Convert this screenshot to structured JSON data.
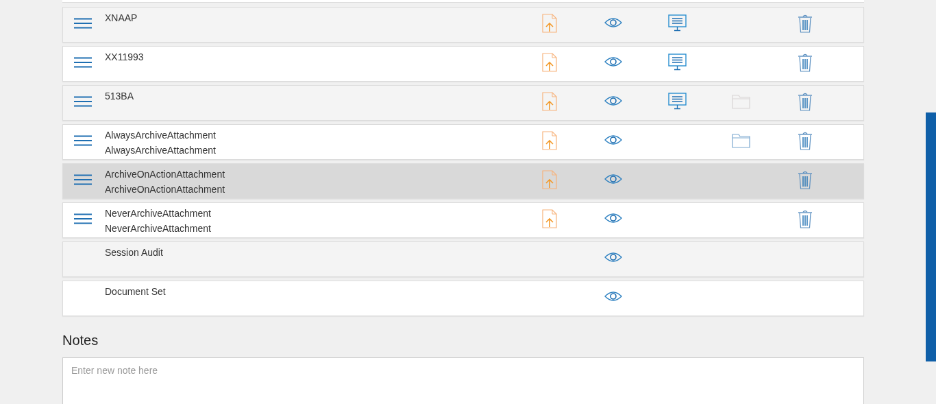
{
  "rows": [
    {
      "lines": [
        "XNAAP"
      ],
      "selected": false,
      "actions": [
        {
          "kind": "drag",
          "disabled": false
        },
        {
          "kind": "upload",
          "disabled": false
        },
        {
          "kind": "view",
          "disabled": false
        },
        {
          "kind": "presentation",
          "disabled": false
        },
        {
          "kind": "delete",
          "disabled": false
        }
      ]
    },
    {
      "lines": [
        "XX11993"
      ],
      "selected": false,
      "actions": [
        {
          "kind": "drag",
          "disabled": false
        },
        {
          "kind": "upload",
          "disabled": false
        },
        {
          "kind": "view",
          "disabled": false
        },
        {
          "kind": "presentation",
          "disabled": false
        },
        {
          "kind": "delete",
          "disabled": false
        }
      ]
    },
    {
      "lines": [
        "513BA"
      ],
      "selected": false,
      "actions": [
        {
          "kind": "drag",
          "disabled": false
        },
        {
          "kind": "upload",
          "disabled": false
        },
        {
          "kind": "view",
          "disabled": false
        },
        {
          "kind": "presentation",
          "disabled": false
        },
        {
          "kind": "folder",
          "disabled": true
        },
        {
          "kind": "delete",
          "disabled": false
        }
      ]
    },
    {
      "lines": [
        "AlwaysArchiveAttachment",
        "AlwaysArchiveAttachment"
      ],
      "selected": false,
      "actions": [
        {
          "kind": "drag",
          "disabled": false
        },
        {
          "kind": "upload",
          "disabled": false
        },
        {
          "kind": "view",
          "disabled": false
        },
        {
          "kind": "folder",
          "disabled": false
        },
        {
          "kind": "delete",
          "disabled": false
        }
      ]
    },
    {
      "lines": [
        "ArchiveOnActionAttachment",
        "ArchiveOnActionAttachment"
      ],
      "selected": true,
      "actions": [
        {
          "kind": "drag",
          "disabled": false
        },
        {
          "kind": "upload",
          "disabled": false
        },
        {
          "kind": "view",
          "disabled": false
        },
        {
          "kind": "delete",
          "disabled": false
        }
      ]
    },
    {
      "lines": [
        "NeverArchiveAttachment",
        "NeverArchiveAttachment"
      ],
      "selected": false,
      "actions": [
        {
          "kind": "drag",
          "disabled": false
        },
        {
          "kind": "upload",
          "disabled": false
        },
        {
          "kind": "view",
          "disabled": false
        },
        {
          "kind": "delete",
          "disabled": false
        }
      ]
    },
    {
      "lines": [
        "Session Audit"
      ],
      "selected": false,
      "actions": [
        {
          "kind": "view",
          "disabled": false
        }
      ]
    },
    {
      "lines": [
        "Document Set"
      ],
      "selected": false,
      "actions": [
        {
          "kind": "view",
          "disabled": false
        }
      ]
    }
  ],
  "notes": {
    "heading": "Notes",
    "placeholder": "Enter new note here"
  }
}
